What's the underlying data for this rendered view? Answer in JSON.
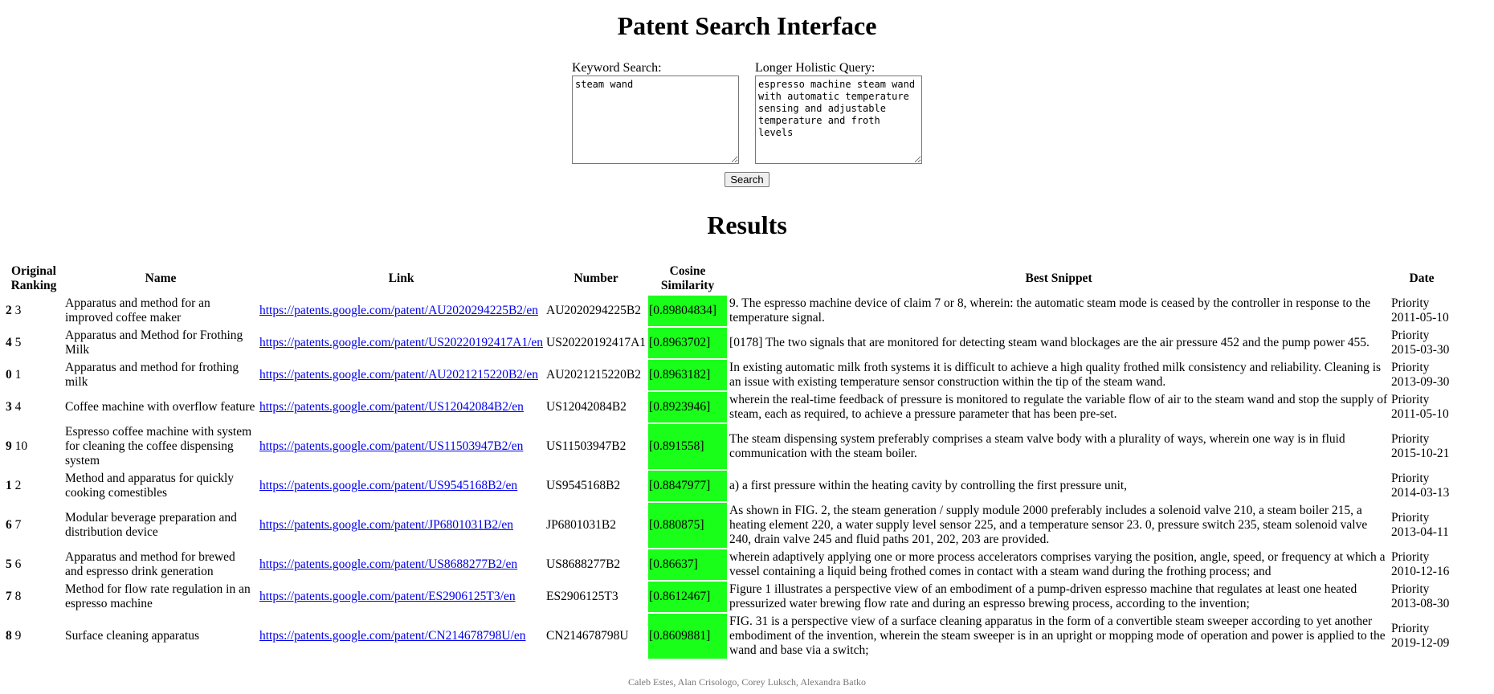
{
  "page": {
    "title": "Patent Search Interface",
    "results_heading": "Results",
    "footer": "Caleb Estes, Alan Crisologo, Corey Luksch, Alexandra Batko"
  },
  "search": {
    "keyword_label": "Keyword Search:",
    "keyword_value": "steam wand",
    "holistic_label": "Longer Holistic Query:",
    "holistic_value": "espresso machine steam wand with automatic temperature sensing and adjustable temperature and froth levels",
    "button_label": "Search"
  },
  "colors": {
    "cosine_bg": "#1aff1a",
    "link": "#0000ee"
  },
  "table": {
    "headers": [
      "Original Ranking",
      "Name",
      "Link",
      "Number",
      "Cosine Similarity",
      "Best Snippet",
      "Date"
    ],
    "rows": [
      {
        "rank_new": "2",
        "rank_orig": "3",
        "name": "Apparatus and method for an improved coffee maker",
        "link": "https://patents.google.com/patent/AU2020294225B2/en",
        "number": "AU2020294225B2",
        "cosine": "[0.89804834]",
        "snippet": "9. The espresso machine device of claim 7 or 8, wherein: the automatic steam mode is ceased by the controller in response to the temperature signal.",
        "date_label": "Priority",
        "date": "2011-05-10"
      },
      {
        "rank_new": "4",
        "rank_orig": "5",
        "name": "Apparatus and Method for Frothing Milk",
        "link": "https://patents.google.com/patent/US20220192417A1/en",
        "number": "US20220192417A1",
        "cosine": "[0.8963702]",
        "snippet": "[0178] The two signals that are monitored for detecting steam wand blockages are the air pressure 452 and the pump power 455.",
        "date_label": "Priority",
        "date": "2015-03-30"
      },
      {
        "rank_new": "0",
        "rank_orig": "1",
        "name": "Apparatus and method for frothing milk",
        "link": "https://patents.google.com/patent/AU2021215220B2/en",
        "number": "AU2021215220B2",
        "cosine": "[0.8963182]",
        "snippet": "In existing automatic milk froth systems it is difficult to achieve a high quality frothed milk consistency and reliability. Cleaning is an issue with existing temperature sensor construction within the tip of the steam wand.",
        "date_label": "Priority",
        "date": "2013-09-30"
      },
      {
        "rank_new": "3",
        "rank_orig": "4",
        "name": "Coffee machine with overflow feature",
        "link": "https://patents.google.com/patent/US12042084B2/en",
        "number": "US12042084B2",
        "cosine": "[0.8923946]",
        "snippet": "wherein the real-time feedback of pressure is monitored to regulate the variable flow of air to the steam wand and stop the supply of steam, each as required, to achieve a pressure parameter that has been pre-set.",
        "date_label": "Priority",
        "date": "2011-05-10"
      },
      {
        "rank_new": "9",
        "rank_orig": "10",
        "name": "Espresso coffee machine with system for cleaning the coffee dispensing system",
        "link": "https://patents.google.com/patent/US11503947B2/en",
        "number": "US11503947B2",
        "cosine": "[0.891558]",
        "snippet": "The steam dispensing system preferably comprises a steam valve body with a plurality of ways, wherein one way is in fluid communication with the steam boiler.",
        "date_label": "Priority",
        "date": "2015-10-21"
      },
      {
        "rank_new": "1",
        "rank_orig": "2",
        "name": "Method and apparatus for quickly cooking comestibles",
        "link": "https://patents.google.com/patent/US9545168B2/en",
        "number": "US9545168B2",
        "cosine": "[0.8847977]",
        "snippet": "a) a first pressure within the heating cavity by controlling the first pressure unit,",
        "date_label": "Priority",
        "date": "2014-03-13"
      },
      {
        "rank_new": "6",
        "rank_orig": "7",
        "name": "Modular beverage preparation and distribution device",
        "link": "https://patents.google.com/patent/JP6801031B2/en",
        "number": "JP6801031B2",
        "cosine": "[0.880875]",
        "snippet": "As shown in FIG. 2, the steam generation / supply module 2000 preferably includes a solenoid valve 210, a steam boiler 215, a heating element 220, a water supply level sensor 225, and a temperature sensor 23. 0, pressure switch 235, steam solenoid valve 240, drain valve 245 and fluid paths 201, 202, 203 are provided.",
        "date_label": "Priority",
        "date": "2013-04-11"
      },
      {
        "rank_new": "5",
        "rank_orig": "6",
        "name": "Apparatus and method for brewed and espresso drink generation",
        "link": "https://patents.google.com/patent/US8688277B2/en",
        "number": "US8688277B2",
        "cosine": "[0.86637]",
        "snippet": "wherein adaptively applying one or more process accelerators comprises varying the position, angle, speed, or frequency at which a vessel containing a liquid being frothed comes in contact with a steam wand during the frothing process; and",
        "date_label": "Priority",
        "date": "2010-12-16"
      },
      {
        "rank_new": "7",
        "rank_orig": "8",
        "name": "Method for flow rate regulation in an espresso machine",
        "link": "https://patents.google.com/patent/ES2906125T3/en",
        "number": "ES2906125T3",
        "cosine": "[0.8612467]",
        "snippet": "Figure 1 illustrates a perspective view of an embodiment of a pump-driven espresso machine that regulates at least one heated pressurized water brewing flow rate and during an espresso brewing process, according to the invention;",
        "date_label": "Priority",
        "date": "2013-08-30"
      },
      {
        "rank_new": "8",
        "rank_orig": "9",
        "name": "Surface cleaning apparatus",
        "link": "https://patents.google.com/patent/CN214678798U/en",
        "number": "CN214678798U",
        "cosine": "[0.8609881]",
        "snippet": "FIG. 31 is a perspective view of a surface cleaning apparatus in the form of a convertible steam sweeper according to yet another embodiment of the invention, wherein the steam sweeper is in an upright or mopping mode of operation and power is applied to the wand and base via a switch;",
        "date_label": "Priority",
        "date": "2019-12-09"
      }
    ]
  }
}
